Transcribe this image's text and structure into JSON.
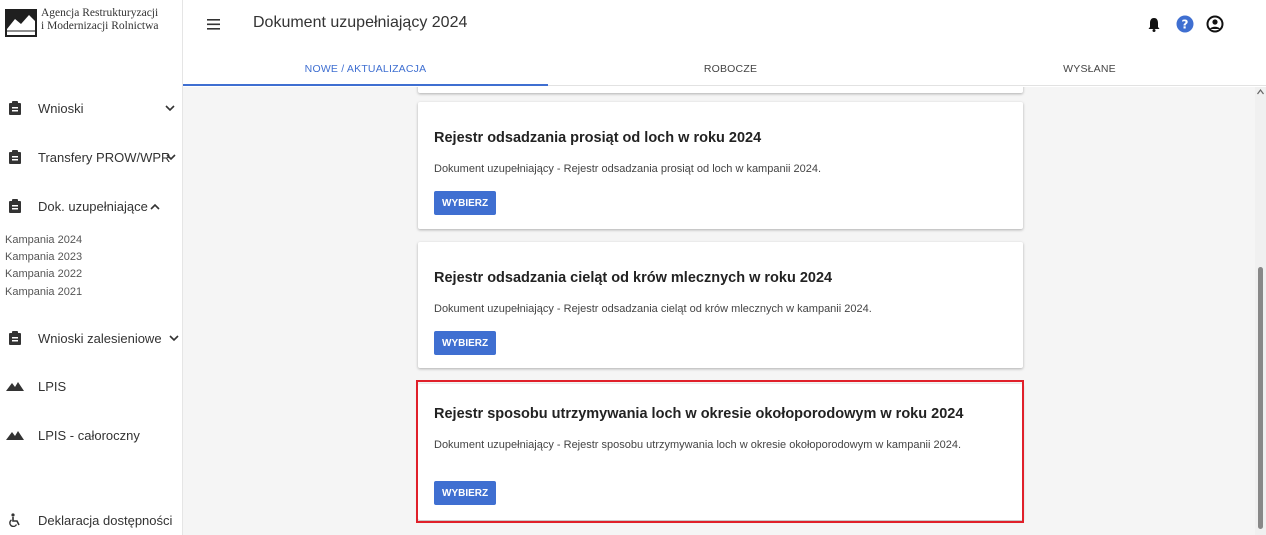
{
  "logo": {
    "line1": "Agencja Restrukturyzacji",
    "line2": "i Modernizacji Rolnictwa"
  },
  "header": {
    "title": "Dokument uzupełniający 2024"
  },
  "tabs": [
    {
      "label": "NOWE / AKTUALIZACJA",
      "active": true
    },
    {
      "label": "ROBOCZE",
      "active": false
    },
    {
      "label": "WYSŁANE",
      "active": false
    }
  ],
  "sidebar": {
    "items": [
      {
        "label": "Wnioski",
        "icon": "clipboard-icon",
        "expanded": false
      },
      {
        "label": "Transfery PROW/WPR",
        "icon": "clipboard-icon",
        "expanded": false
      },
      {
        "label": "Dok. uzupełniające",
        "icon": "clipboard-icon",
        "expanded": true
      },
      {
        "label": "Wnioski zalesieniowe",
        "icon": "clipboard-icon",
        "expanded": false
      },
      {
        "label": "LPIS",
        "icon": "mountain-icon"
      },
      {
        "label": "LPIS - całoroczny",
        "icon": "mountain-icon"
      },
      {
        "label": "Deklaracja dostępności",
        "icon": "wheelchair-icon"
      }
    ],
    "subitems": [
      "Kampania 2024",
      "Kampania 2023",
      "Kampania 2022",
      "Kampania 2021"
    ]
  },
  "cards": [
    {
      "title": "Rejestr odsadzania prosiąt od loch w roku 2024",
      "description": "Dokument uzupełniający - Rejestr odsadzania prosiąt od loch w kampanii 2024.",
      "button": "WYBIERZ"
    },
    {
      "title": "Rejestr odsadzania cieląt od krów mlecznych w roku 2024",
      "description": "Dokument uzupełniający - Rejestr odsadzania cieląt od krów mlecznych w kampanii 2024.",
      "button": "WYBIERZ"
    },
    {
      "title": "Rejestr sposobu utrzymywania loch w okresie okołoporodowym w roku 2024",
      "description": "Dokument uzupełniający - Rejestr sposobu utrzymywania loch w okresie okołoporodowym w kampanii 2024.",
      "button": "WYBIERZ"
    }
  ],
  "colors": {
    "accent": "#3f6fd1",
    "highlight": "#e0202a",
    "content_bg": "#f5f5f5"
  }
}
